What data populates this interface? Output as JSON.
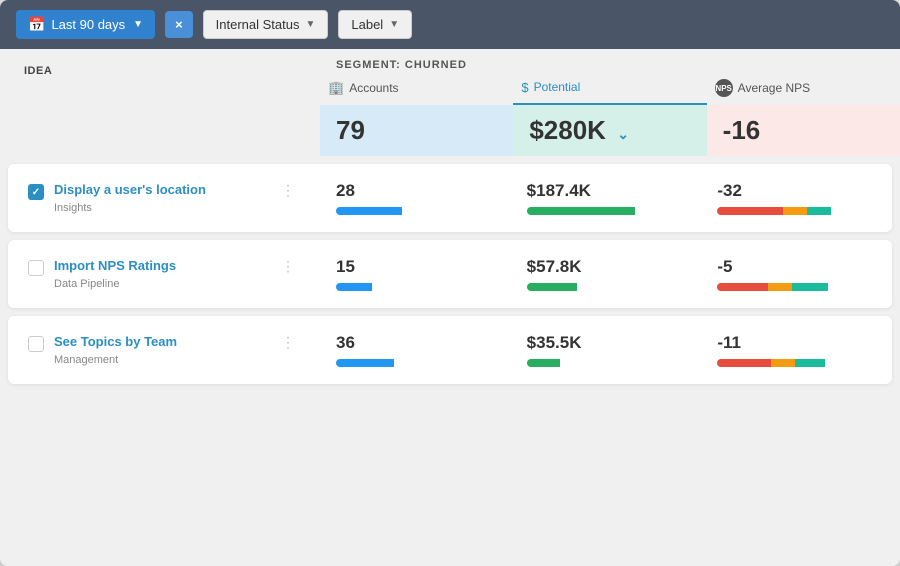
{
  "topbar": {
    "period_label": "Last 90 days",
    "close_label": "×",
    "internal_status_label": "Internal Status",
    "label_label": "Label"
  },
  "table": {
    "idea_col_header": "IDEA",
    "segment_label": "SEGMENT: CHURNED",
    "columns": [
      {
        "id": "accounts",
        "icon": "🏢",
        "label": "Accounts"
      },
      {
        "id": "potential",
        "icon": "$",
        "label": "Potential"
      },
      {
        "id": "avg_nps",
        "icon": "NPS",
        "label": "Average NPS"
      }
    ],
    "active_column": "potential",
    "summary": {
      "accounts": "79",
      "potential": "$280K",
      "avg_nps": "-16"
    },
    "items": [
      {
        "id": 1,
        "title": "Display a user's location",
        "category": "Insights",
        "checked": true,
        "accounts": "28",
        "potential": "$187.4K",
        "avg_nps": "-32",
        "accounts_bar": [
          {
            "color": "blue",
            "pct": 55
          }
        ],
        "potential_bar": [
          {
            "color": "green",
            "pct": 90
          }
        ],
        "nps_bar": [
          {
            "color": "red",
            "pct": 55
          },
          {
            "color": "orange",
            "pct": 20
          },
          {
            "color": "teal",
            "pct": 20
          }
        ]
      },
      {
        "id": 2,
        "title": "Import NPS Ratings",
        "category": "Data Pipeline",
        "checked": false,
        "accounts": "15",
        "potential": "$57.8K",
        "avg_nps": "-5",
        "accounts_bar": [
          {
            "color": "blue",
            "pct": 30
          }
        ],
        "potential_bar": [
          {
            "color": "green",
            "pct": 42
          }
        ],
        "nps_bar": [
          {
            "color": "red",
            "pct": 42
          },
          {
            "color": "orange",
            "pct": 20
          },
          {
            "color": "teal",
            "pct": 30
          }
        ]
      },
      {
        "id": 3,
        "title": "See Topics by Team",
        "category": "Management",
        "checked": false,
        "accounts": "36",
        "potential": "$35.5K",
        "avg_nps": "-11",
        "accounts_bar": [
          {
            "color": "blue",
            "pct": 48
          }
        ],
        "potential_bar": [
          {
            "color": "green",
            "pct": 28
          }
        ],
        "nps_bar": [
          {
            "color": "red",
            "pct": 45
          },
          {
            "color": "orange",
            "pct": 20
          },
          {
            "color": "teal",
            "pct": 25
          }
        ]
      }
    ]
  }
}
